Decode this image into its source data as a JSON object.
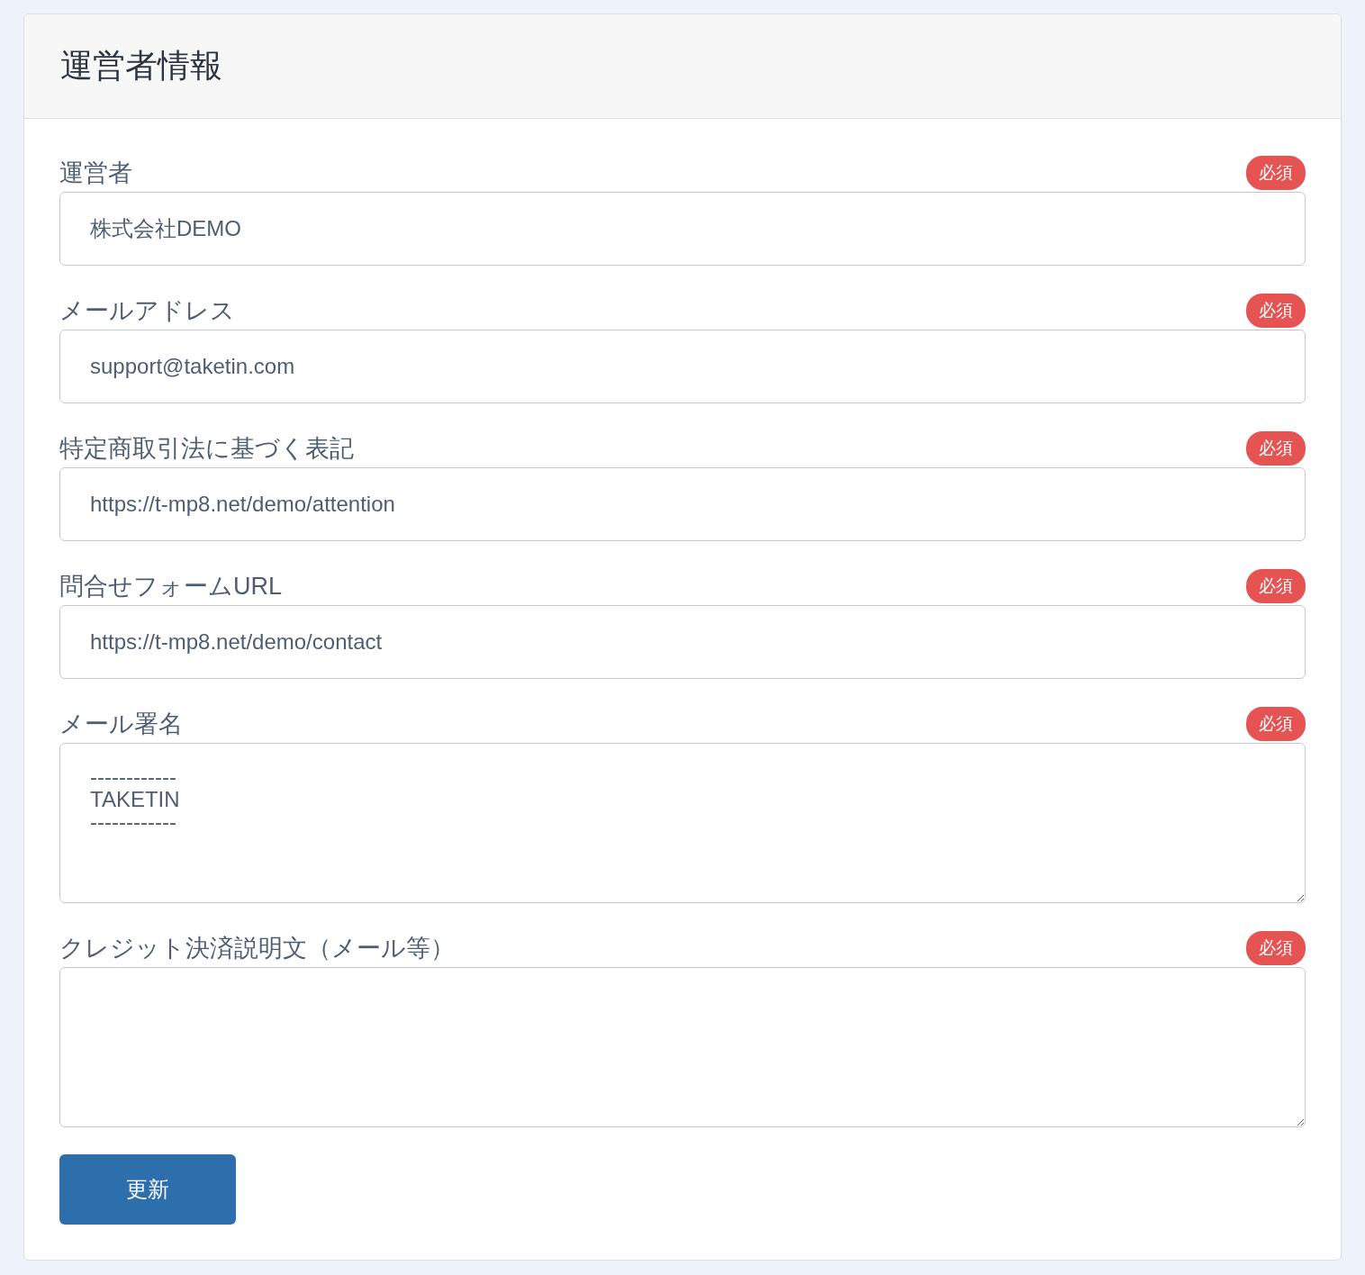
{
  "card": {
    "title": "運営者情報"
  },
  "fields": [
    {
      "kind": "input",
      "label": "運営者",
      "badge": "必須",
      "value": "株式会社DEMO"
    },
    {
      "kind": "input",
      "label": "メールアドレス",
      "badge": "必須",
      "value": "support@taketin.com"
    },
    {
      "kind": "input",
      "label": "特定商取引法に基づく表記",
      "badge": "必須",
      "value": "https://t-mp8.net/demo/attention"
    },
    {
      "kind": "input",
      "label": "問合せフォームURL",
      "badge": "必須",
      "value": "https://t-mp8.net/demo/contact"
    },
    {
      "kind": "textarea",
      "label": "メール署名",
      "badge": "必須",
      "value": "------------\nTAKETIN\n------------"
    },
    {
      "kind": "textarea",
      "label": "クレジット決済説明文（メール等）",
      "badge": "必須"
    }
  ],
  "submit_button": "更新"
}
